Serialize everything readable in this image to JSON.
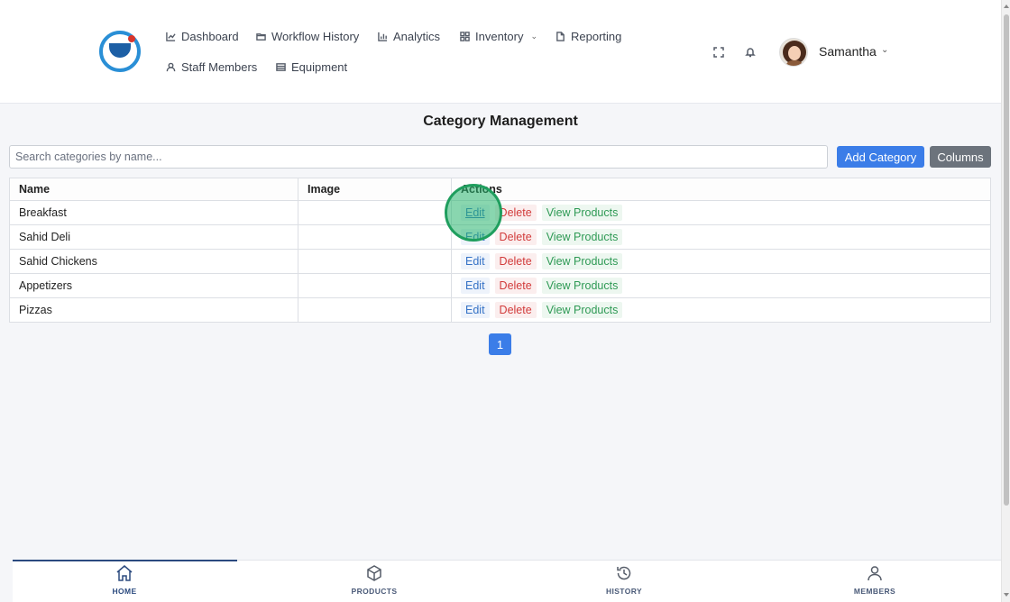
{
  "header": {
    "nav": {
      "dashboard": "Dashboard",
      "workflow_history": "Workflow History",
      "analytics": "Analytics",
      "inventory": "Inventory",
      "reporting": "Reporting",
      "staff_members": "Staff Members",
      "equipment": "Equipment"
    },
    "user_name": "Samantha"
  },
  "page": {
    "title": "Category Management",
    "search_placeholder": "Search categories by name...",
    "add_button": "Add Category",
    "columns_button": "Columns"
  },
  "table": {
    "headers": [
      "Name",
      "Image",
      "Actions"
    ],
    "rows": [
      {
        "name": "Breakfast"
      },
      {
        "name": "Sahid Deli"
      },
      {
        "name": "Sahid Chickens"
      },
      {
        "name": "Appetizers"
      },
      {
        "name": "Pizzas"
      }
    ],
    "actions": {
      "edit": "Edit",
      "delete": "Delete",
      "view": "View Products"
    }
  },
  "pagination": {
    "current_page": "1"
  },
  "bottom_nav": {
    "home": "HOME",
    "products": "PRODUCTS",
    "history": "HISTORY",
    "members": "MEMBERS",
    "active": "home"
  },
  "colors": {
    "primary": "#3b7de8",
    "secondary": "#6c737c",
    "edit": "#3572c6",
    "delete": "#d23b3b",
    "view": "#2f9a55",
    "nav_active": "#2b4a7f"
  }
}
